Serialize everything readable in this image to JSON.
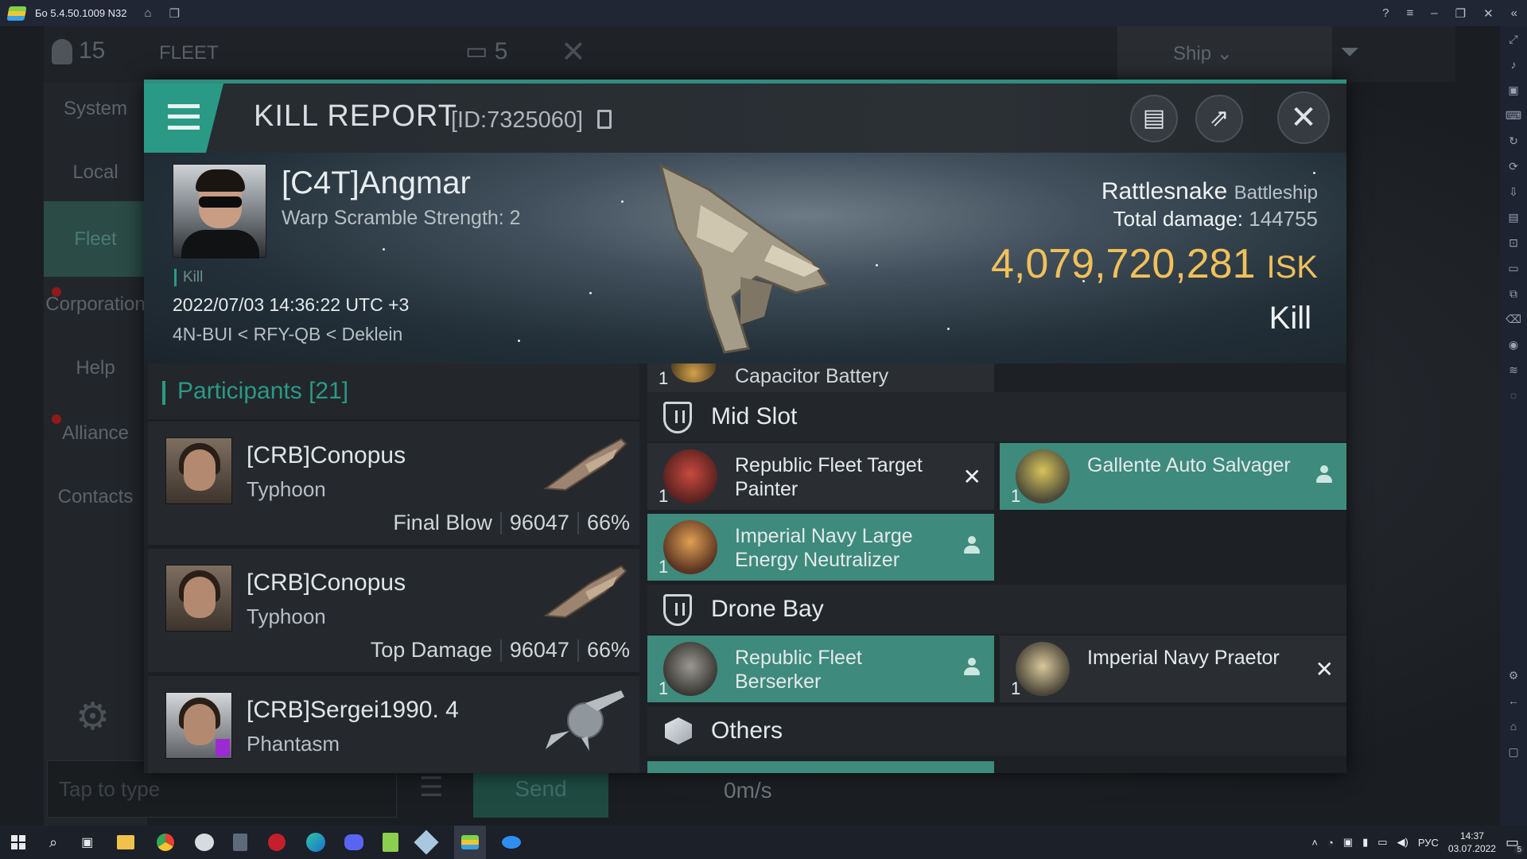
{
  "emulator": {
    "title": "Бо 5.4.50.1009 N32"
  },
  "game": {
    "member_count": "15",
    "fleet_tab": "FLEET",
    "fleet_count": "5",
    "ship_filter": "Ship",
    "speed": "0m/s",
    "nav": [
      {
        "label": "System"
      },
      {
        "label": "Local"
      },
      {
        "label": "Fleet"
      },
      {
        "label": "Corporation"
      },
      {
        "label": "Help"
      },
      {
        "label": "Alliance"
      },
      {
        "label": "Contacts"
      }
    ],
    "chat": {
      "placeholder": "Tap to type",
      "send_label": "Send"
    }
  },
  "kill_report": {
    "title": "KILL REPORT",
    "id": "[ID:7325060]",
    "victim": {
      "name": "[C4T]Angmar",
      "subtitle": "Warp Scramble Strength: 2",
      "kill_tag": "Kill",
      "timestamp": "2022/07/03 14:36:22 UTC +3",
      "location": "4N-BUI < RFY-QB < Deklein",
      "ship_name": "Rattlesnake",
      "ship_class": "Battleship",
      "total_damage_label": "Total damage:",
      "total_damage_value": "144755",
      "isk_value": "4,079,720,281",
      "isk_unit": "ISK",
      "result": "Kill"
    },
    "participants": {
      "title": "Participants",
      "count": "[21]",
      "rows": [
        {
          "name": "[CRB]Conopus",
          "ship": "Typhoon",
          "role": "Final Blow",
          "damage": "96047",
          "percent": "66%"
        },
        {
          "name": "[CRB]Conopus",
          "ship": "Typhoon",
          "role": "Top Damage",
          "damage": "96047",
          "percent": "66%"
        },
        {
          "name": "[CRB]Sergei1990. 4",
          "ship": "Phantasm"
        }
      ]
    },
    "fitting": {
      "partial_item": {
        "qty": "1",
        "name": "Capacitor Battery"
      },
      "mid_slot": {
        "label": "Mid Slot",
        "items": [
          {
            "qty": "1",
            "name": "Republic Fleet Target Painter",
            "state": "destroyed"
          },
          {
            "qty": "1",
            "name": "Gallente Auto Salvager",
            "state": "dropped"
          },
          {
            "qty": "1",
            "name": "Imperial Navy Large Energy Neutralizer",
            "state": "dropped"
          }
        ]
      },
      "drone_bay": {
        "label": "Drone Bay",
        "items": [
          {
            "qty": "1",
            "name": "Republic Fleet Berserker",
            "state": "dropped"
          },
          {
            "qty": "1",
            "name": "Imperial Navy Praetor",
            "state": "destroyed"
          }
        ]
      },
      "others": {
        "label": "Others"
      }
    }
  },
  "taskbar": {
    "lang": "РУС",
    "time": "14:37",
    "date": "03.07.2022",
    "notifications": "5"
  },
  "colors": {
    "accent": "#2a9a86",
    "dropped": "#3e8a7c",
    "isk": "#f2c05a"
  }
}
